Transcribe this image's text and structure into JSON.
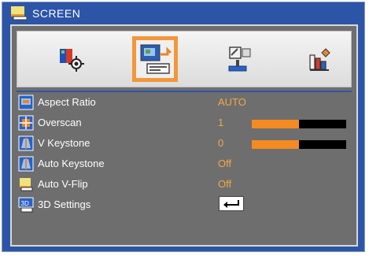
{
  "window": {
    "title": "SCREEN"
  },
  "tabs": [
    {
      "name": "image-settings",
      "icon": "image-settings-icon",
      "selected": false
    },
    {
      "name": "screen",
      "icon": "screen-settings-icon",
      "selected": true
    },
    {
      "name": "setup",
      "icon": "setup-icon",
      "selected": false
    },
    {
      "name": "options",
      "icon": "options-icon",
      "selected": false
    }
  ],
  "rows": [
    {
      "label": "Aspect Ratio",
      "value": "AUTO",
      "icon": "aspect-ratio-icon"
    },
    {
      "label": "Overscan",
      "value": "1",
      "icon": "overscan-icon",
      "level": 0.5
    },
    {
      "label": "V Keystone",
      "value": "0",
      "icon": "v-keystone-icon",
      "level": 0.5
    },
    {
      "label": "Auto Keystone",
      "value": "Off",
      "icon": "auto-keystone-icon"
    },
    {
      "label": "Auto V-Flip",
      "value": "Off",
      "icon": "auto-v-flip-icon"
    },
    {
      "label": "3D Settings",
      "value": "",
      "icon": "3d-settings-icon",
      "action_icon": "enter-key-icon"
    }
  ],
  "colors": {
    "frame": "#2c55a7",
    "panel": "#6e6e6e",
    "accent": "#f2973a",
    "value_text": "#f0a848",
    "bar_fill": "#f48a22"
  }
}
